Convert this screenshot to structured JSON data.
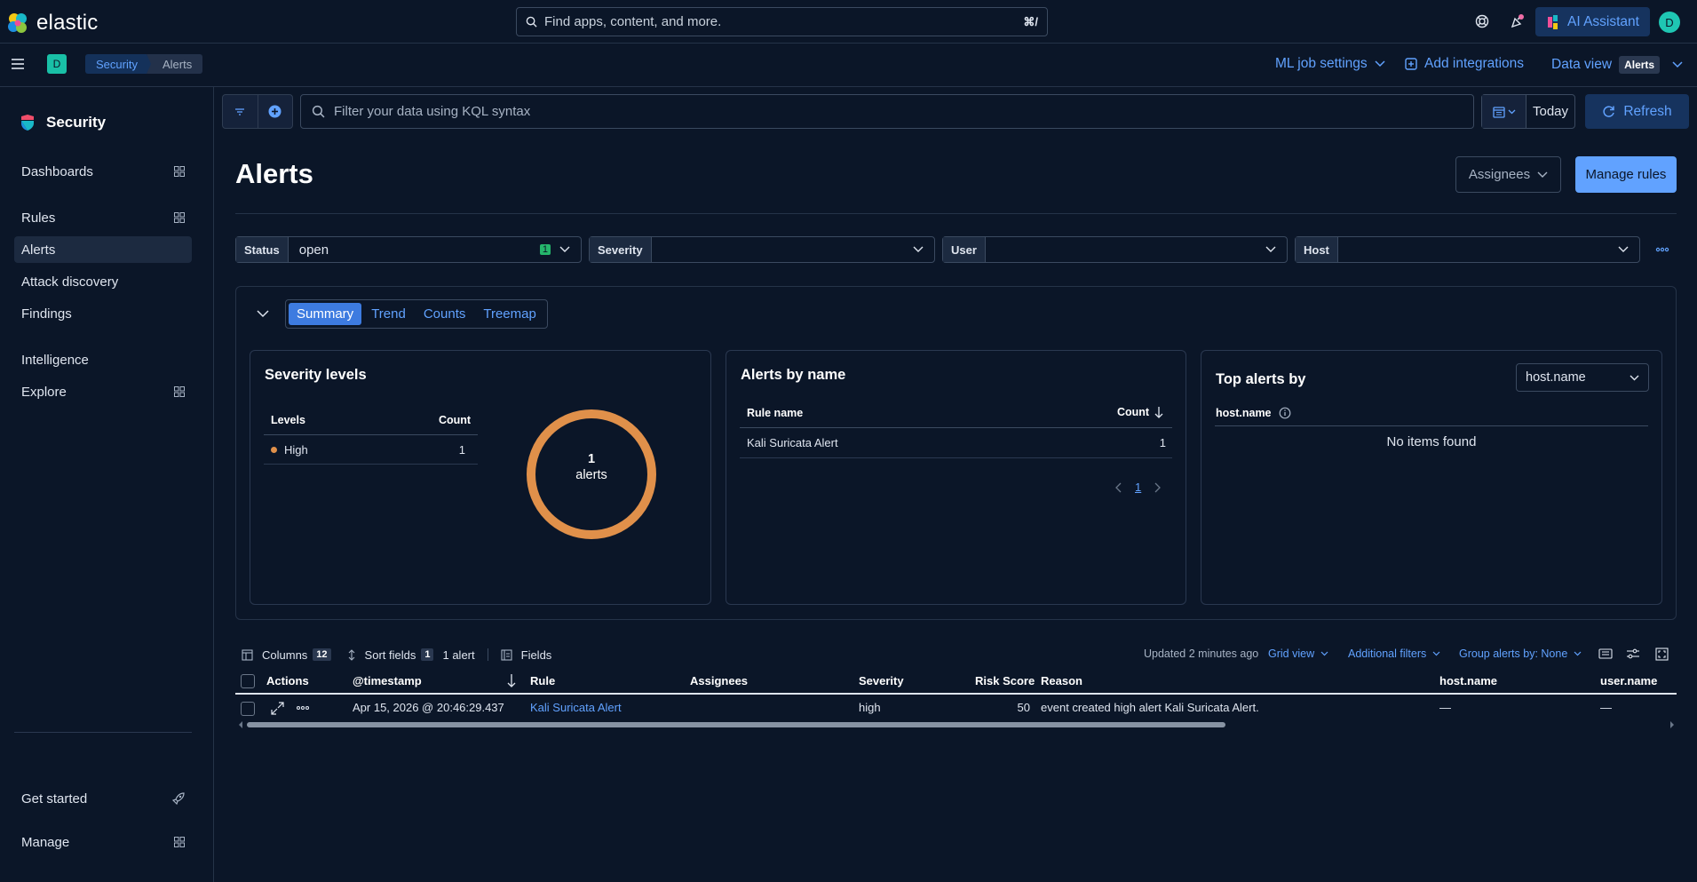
{
  "header": {
    "brand": "elastic",
    "search_placeholder": "Find apps, content, and more.",
    "search_shortcut": "⌘/",
    "ai_assistant_label": "AI Assistant",
    "avatar_initial": "D"
  },
  "subheader": {
    "space_initial": "D",
    "breadcrumbs": [
      "Security",
      "Alerts"
    ],
    "ml_job_settings": "ML job settings",
    "add_integrations": "Add integrations",
    "data_view_label": "Data view",
    "data_view_value": "Alerts"
  },
  "sidebar": {
    "title": "Security",
    "items": [
      {
        "label": "Dashboards"
      },
      {
        "label": "Rules"
      },
      {
        "label": "Alerts"
      },
      {
        "label": "Attack discovery"
      },
      {
        "label": "Findings"
      },
      {
        "label": "Intelligence"
      },
      {
        "label": "Explore"
      },
      {
        "label": "Get started"
      },
      {
        "label": "Manage"
      }
    ],
    "active": "Alerts"
  },
  "query_bar": {
    "kql_placeholder": "Filter your data using KQL syntax",
    "date_label": "Today",
    "refresh_label": "Refresh"
  },
  "page": {
    "title": "Alerts",
    "assignees_label": "Assignees",
    "manage_rules_label": "Manage rules"
  },
  "filters": [
    {
      "label": "Status",
      "value": "open",
      "count": "1"
    },
    {
      "label": "Severity",
      "value": ""
    },
    {
      "label": "User",
      "value": ""
    },
    {
      "label": "Host",
      "value": ""
    }
  ],
  "chart_tabs": [
    "Summary",
    "Trend",
    "Counts",
    "Treemap"
  ],
  "severity_card": {
    "title": "Severity levels",
    "col_levels": "Levels",
    "col_count": "Count",
    "rows": [
      {
        "level": "High",
        "count": "1",
        "color": "#e0904a"
      }
    ],
    "donut_count": "1",
    "donut_label": "alerts"
  },
  "alerts_by_name": {
    "title": "Alerts by name",
    "col_rule": "Rule name",
    "col_count": "Count",
    "rows": [
      {
        "rule": "Kali Suricata Alert",
        "count": "1"
      }
    ],
    "page": "1"
  },
  "top_alerts": {
    "title": "Top alerts by",
    "select_value": "host.name",
    "col_field": "host.name",
    "empty": "No items found"
  },
  "table": {
    "columns_label": "Columns",
    "columns_count": "12",
    "sort_label": "Sort fields",
    "sort_count": "1",
    "alert_count": "1 alert",
    "fields_label": "Fields",
    "updated": "Updated 2 minutes ago",
    "grid_view": "Grid view",
    "additional_filters": "Additional filters",
    "group_by": "Group alerts by: None",
    "headers": {
      "actions": "Actions",
      "timestamp": "@timestamp",
      "rule": "Rule",
      "assignees": "Assignees",
      "severity": "Severity",
      "risk": "Risk Score",
      "reason": "Reason",
      "host": "host.name",
      "user": "user.name"
    },
    "rows": [
      {
        "timestamp": "Apr 15, 2026 @ 20:46:29.437",
        "rule": "Kali Suricata Alert",
        "assignees": "",
        "severity": "high",
        "risk": "50",
        "reason": "event created high alert Kali Suricata Alert.",
        "host": "—",
        "user": "—"
      }
    ]
  }
}
